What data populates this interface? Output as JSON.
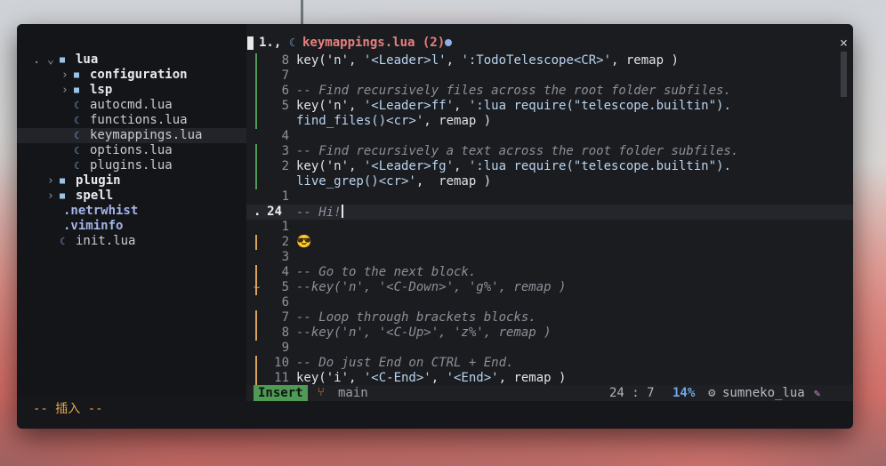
{
  "file_tree": {
    "items": [
      {
        "indent": 0,
        "arrow": ".",
        "expander": "⌄",
        "icon": "folder",
        "label": "lua",
        "bold": true
      },
      {
        "indent": 1,
        "expander": "›",
        "icon": "folder",
        "label": "configuration",
        "bold": true
      },
      {
        "indent": 1,
        "expander": "›",
        "icon": "folder",
        "label": "lsp",
        "bold": true
      },
      {
        "indent": 1,
        "icon": "lua",
        "label": "autocmd.lua"
      },
      {
        "indent": 1,
        "icon": "lua",
        "label": "functions.lua"
      },
      {
        "indent": 1,
        "icon": "lua",
        "label": "keymappings.lua",
        "selected": true
      },
      {
        "indent": 1,
        "icon": "lua",
        "label": "options.lua"
      },
      {
        "indent": 1,
        "icon": "lua",
        "label": "plugins.lua"
      },
      {
        "indent": 0,
        "expander": "›",
        "icon": "folder",
        "label": "plugin",
        "bold": true
      },
      {
        "indent": 0,
        "expander": "›",
        "icon": "folder",
        "label": "spell",
        "bold": true
      },
      {
        "indent": 0,
        "icon": "none",
        "label": ".netrwhist",
        "hidden": true
      },
      {
        "indent": 0,
        "icon": "none",
        "label": ".viminfo",
        "hidden": true
      },
      {
        "indent": 0,
        "icon": "lua",
        "label": "init.lua"
      }
    ]
  },
  "tab": {
    "number": "1.,",
    "title": "keymappings.lua (2)",
    "close": "×"
  },
  "editor": {
    "lines": [
      {
        "num": "8",
        "bar": "green",
        "code": [
          [
            "key('n', ",
            ""
          ],
          [
            "'<Leader>l'",
            "str"
          ],
          [
            ", ",
            ""
          ],
          [
            "':TodoTelescope<CR>'",
            "str"
          ],
          [
            ", remap )",
            ""
          ]
        ]
      },
      {
        "num": "7",
        "bar": "green",
        "code": []
      },
      {
        "num": "6",
        "bar": "green",
        "code": [
          [
            "-- Find recursively files across the root folder subfiles.",
            "comment"
          ]
        ]
      },
      {
        "num": "5",
        "bar": "green",
        "code": [
          [
            "key('n', ",
            ""
          ],
          [
            "'<Leader>ff'",
            "str"
          ],
          [
            ", ",
            ""
          ],
          [
            "':lua require(\"telescope.builtin\").",
            "str"
          ]
        ]
      },
      {
        "num": "",
        "bar": "green",
        "code": [
          [
            "find_files()<cr>'",
            "str"
          ],
          [
            ", remap )",
            ""
          ]
        ]
      },
      {
        "num": "4",
        "bar": "",
        "code": []
      },
      {
        "num": "3",
        "bar": "green",
        "code": [
          [
            "-- Find recursively a text across the root folder subfiles.",
            "comment"
          ]
        ]
      },
      {
        "num": "2",
        "bar": "green",
        "code": [
          [
            "key('n', ",
            ""
          ],
          [
            "'<Leader>fg'",
            "str"
          ],
          [
            ", ",
            ""
          ],
          [
            "':lua require(\"telescope.builtin\").",
            "str"
          ]
        ]
      },
      {
        "num": "",
        "bar": "green",
        "code": [
          [
            "live_grep()<cr>'",
            "str"
          ],
          [
            ",  remap )",
            ""
          ]
        ]
      },
      {
        "num": "1",
        "bar": "",
        "code": []
      },
      {
        "num": "24",
        "prefix": ".",
        "current": true,
        "bar": "",
        "code": [
          [
            "-- Hi!",
            "comment"
          ]
        ],
        "cursor": true
      },
      {
        "num": "1",
        "bar": "",
        "code": []
      },
      {
        "num": "2",
        "bar": "orange",
        "code": [
          [
            "😎",
            ""
          ]
        ]
      },
      {
        "num": "3",
        "bar": "",
        "code": []
      },
      {
        "num": "4",
        "bar": "orange",
        "code": [
          [
            "-- Go to the next block.",
            "comment"
          ]
        ]
      },
      {
        "num": "5",
        "bar": "orange",
        "sign": "~",
        "code": [
          [
            "--key('n', '<C-Down>', 'g%', remap )",
            "comment"
          ]
        ]
      },
      {
        "num": "6",
        "bar": "",
        "code": []
      },
      {
        "num": "7",
        "bar": "orange",
        "code": [
          [
            "-- Loop through brackets blocks.",
            "comment"
          ]
        ]
      },
      {
        "num": "8",
        "bar": "orange",
        "code": [
          [
            "--key('n', '<C-Up>', 'z%', remap )",
            "comment"
          ]
        ]
      },
      {
        "num": "9",
        "bar": "",
        "code": []
      },
      {
        "num": "10",
        "bar": "orange",
        "code": [
          [
            "-- Do just End on CTRL + End.",
            "comment"
          ]
        ]
      },
      {
        "num": "11",
        "bar": "orange",
        "code": [
          [
            "key('i', ",
            ""
          ],
          [
            "'<C-End>'",
            "str"
          ],
          [
            ", ",
            ""
          ],
          [
            "'<End>'",
            "str"
          ],
          [
            ", remap )",
            ""
          ]
        ]
      }
    ]
  },
  "statusline": {
    "mode": "Insert",
    "branch_icon": "git-branch-icon",
    "branch": "main",
    "position": "24 : 7",
    "percent": "14%",
    "lsp_icon": "⚙",
    "lsp": "sumneko_lua"
  },
  "cmdline": "-- 插入 --",
  "colors": {
    "accent_tab": "#e7807f",
    "mode_bg": "#4f9a55",
    "percent": "#6fa6e8",
    "git_added": "#4f9a55",
    "git_changed": "#d7a35a"
  }
}
